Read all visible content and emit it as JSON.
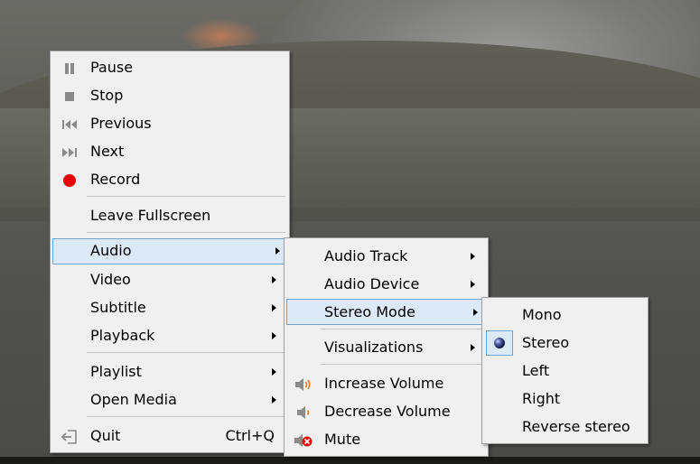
{
  "main_menu": {
    "pause": "Pause",
    "stop": "Stop",
    "previous": "Previous",
    "next": "Next",
    "record": "Record",
    "leave_fullscreen": "Leave Fullscreen",
    "audio": "Audio",
    "video": "Video",
    "subtitle": "Subtitle",
    "playback": "Playback",
    "playlist": "Playlist",
    "open_media": "Open Media",
    "quit": "Quit",
    "quit_shortcut": "Ctrl+Q"
  },
  "audio_menu": {
    "audio_track": "Audio Track",
    "audio_device": "Audio Device",
    "stereo_mode": "Stereo Mode",
    "visualizations": "Visualizations",
    "increase_volume": "Increase Volume",
    "decrease_volume": "Decrease Volume",
    "mute": "Mute"
  },
  "stereo_menu": {
    "mono": "Mono",
    "stereo": "Stereo",
    "left": "Left",
    "right": "Right",
    "reverse_stereo": "Reverse stereo",
    "selected": "Stereo"
  },
  "colors": {
    "menu_bg": "#f0f0f0",
    "highlight_bg": "#dbe9f8",
    "highlight_border": "#6fa3d6",
    "record_red": "#e8000b",
    "volume_orange": "#e07a1f"
  },
  "icons": {
    "pause": "pause-icon",
    "stop": "stop-icon",
    "previous": "previous-icon",
    "next": "next-icon",
    "record": "record-icon",
    "quit": "quit-icon",
    "increase_volume": "volume-up-icon",
    "decrease_volume": "volume-down-icon",
    "mute": "mute-icon",
    "stereo_selected": "radio-dot-icon"
  }
}
